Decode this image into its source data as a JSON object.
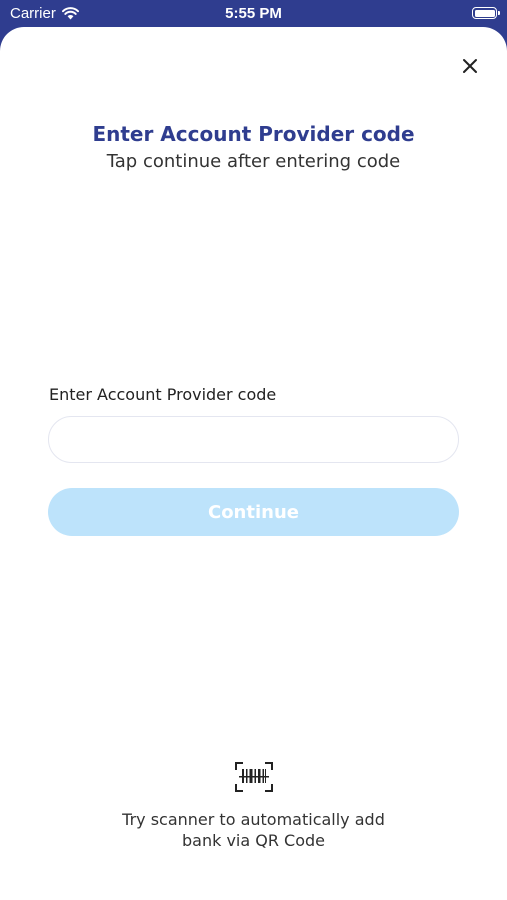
{
  "status_bar": {
    "carrier": "Carrier",
    "time": "5:55 PM",
    "icons": [
      "wifi-icon",
      "battery-icon"
    ]
  },
  "header": {
    "title": "Enter Account Provider code",
    "subtitle": "Tap continue after entering code",
    "close_icon": "close-icon"
  },
  "form": {
    "label": "Enter Account Provider code",
    "input_value": "",
    "input_placeholder": "",
    "continue_label": "Continue",
    "continue_enabled": false
  },
  "scanner": {
    "icon": "barcode-scanner-icon",
    "line1": "Try scanner to automatically add",
    "line2": "bank via QR Code"
  },
  "colors": {
    "brand": "#2f3d8f",
    "button_disabled": "#bde3fb",
    "input_border": "#e4e6f0"
  }
}
